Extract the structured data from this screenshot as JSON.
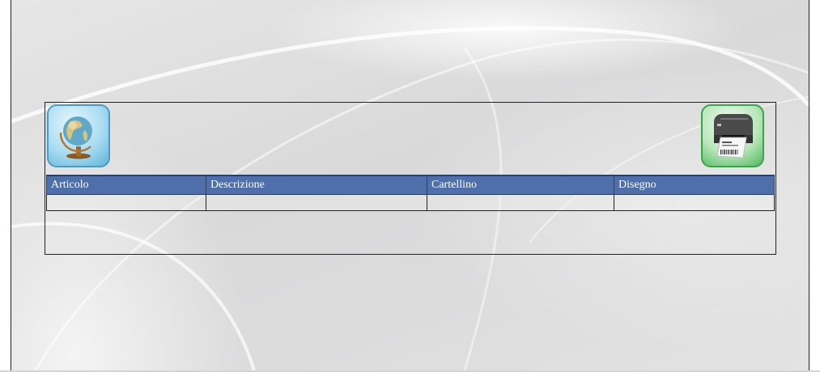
{
  "toolbar": {
    "left_icon": "globe-icon",
    "right_icon": "label-printer-icon"
  },
  "table": {
    "columns": [
      "Articolo",
      "Descrizione",
      "Cartellino",
      "Disegno"
    ],
    "rows": [
      [
        "",
        "",
        "",
        ""
      ]
    ]
  },
  "colors": {
    "header_background": "#4e6faa",
    "header_text": "#ffffff",
    "globe_button_border": "#4a9bc4",
    "printer_button_border": "#3ba54c"
  }
}
